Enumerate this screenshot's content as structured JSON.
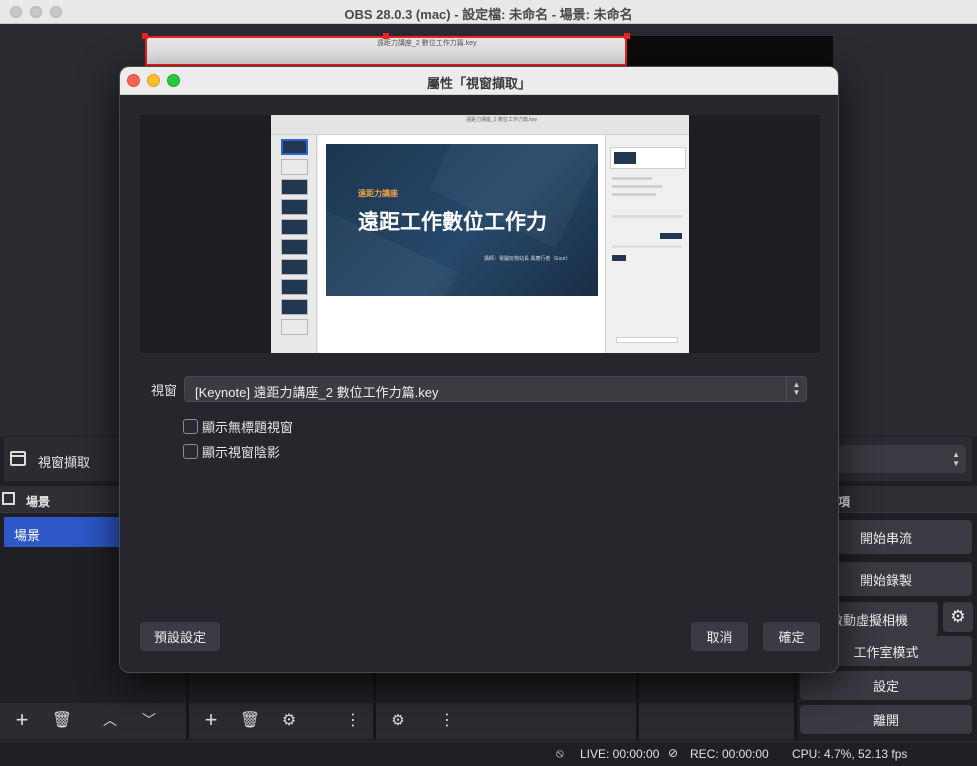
{
  "window": {
    "title": "OBS 28.0.3 (mac) - 設定檔: 未命名 - 場景: 未命名"
  },
  "canvas": {
    "source_caption": "遠距力講座_2 數位工作力篇.key"
  },
  "source_toolbar": {
    "selected_source": "視窗擷取"
  },
  "scenes_dock": {
    "title": "場景",
    "items": [
      "場景"
    ]
  },
  "controls_dock": {
    "title_fragment": "項",
    "buttons": [
      "開始串流",
      "開始錄製",
      "啟動虛擬相機",
      "工作室模式",
      "設定",
      "離開"
    ]
  },
  "status": {
    "live": "LIVE: 00:00:00",
    "rec": "REC: 00:00:00",
    "cpu": "CPU: 4.7%, 52.13 fps"
  },
  "dialog": {
    "title": "屬性「視窗擷取」",
    "window_label": "視窗",
    "window_value": "[Keynote] 遠距力講座_2 數位工作力篇.key",
    "checkbox_untitled": "顯示無標題視窗",
    "checkbox_shadow": "顯示視窗陰影",
    "defaults_button": "預設設定",
    "cancel_button": "取消",
    "ok_button": "確定"
  },
  "preview_slide": {
    "window_caption": "遠距力講座_2 數位工作力篇.key",
    "subtitle": "遠距力講座",
    "title": "遠距工作數位工作力",
    "byline": "講師：電腦玩物站長 異塵行者（Esor）"
  },
  "colors": {
    "accent_blue": "#2e58c8",
    "close": "#fe5f57",
    "minimize": "#febc2e",
    "zoom": "#28c840"
  }
}
